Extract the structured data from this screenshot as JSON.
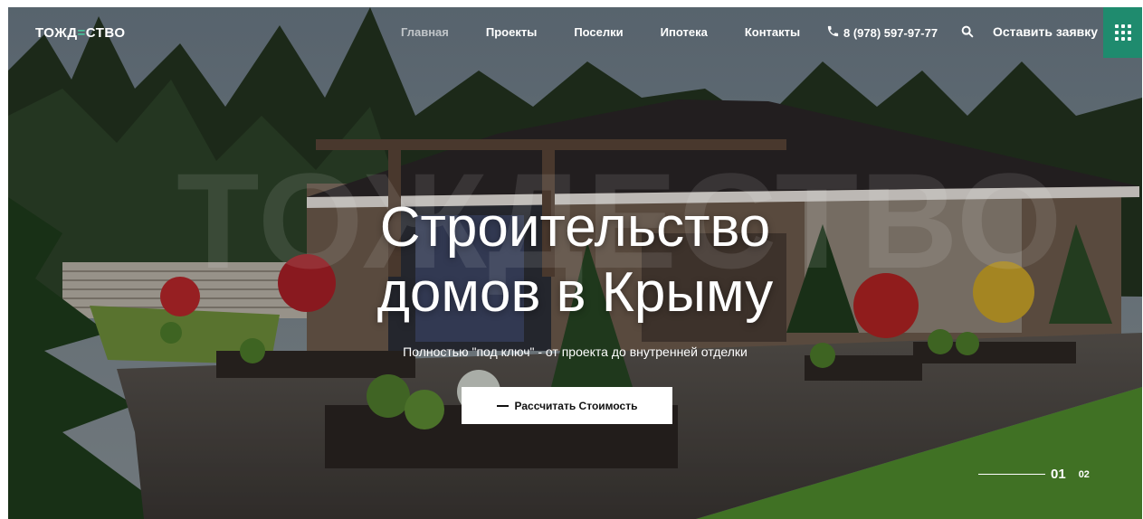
{
  "brand": {
    "logo_part1": "ТОЖД",
    "logo_accent": "=",
    "logo_part2": "СТВО"
  },
  "nav": {
    "items": [
      "Главная",
      "Проекты",
      "Поселки",
      "Ипотека",
      "Контакты"
    ],
    "active": "Главная"
  },
  "header": {
    "phone": "8 (978) 597-97-77",
    "request_label": "Оставить заявку"
  },
  "hero": {
    "watermark": "ТОЖДЕСТВО",
    "title_line1": "Строительство",
    "title_line2": "домов в Крыму",
    "subtitle": "Полностью \"под ключ\" - от проекта до внутренней отделки",
    "button_label": "Рассчитать Стоимость"
  },
  "slider": {
    "current": "01",
    "next": "02"
  },
  "colors": {
    "accent": "#1f8b6e",
    "logo_accent": "#48c29a"
  },
  "icons": {
    "phone": "phone-icon",
    "search": "search-icon",
    "menu": "grid-menu-icon"
  }
}
